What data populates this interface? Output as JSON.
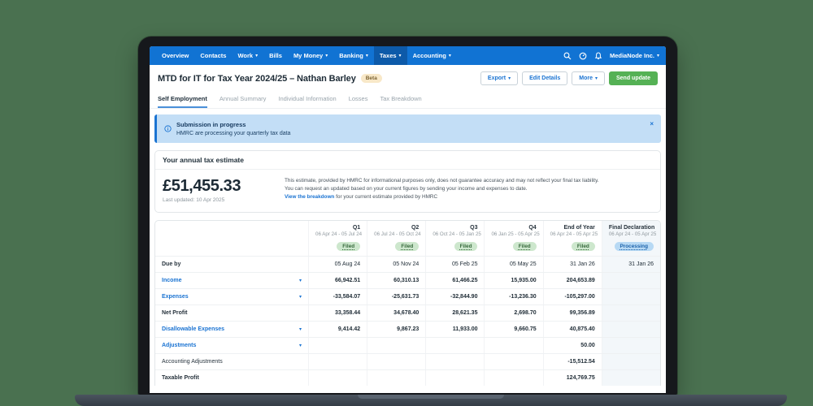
{
  "colors": {
    "background_green": "#4a7150",
    "navbar_blue": "#1173d3",
    "navbar_active_blue": "#0d5aa9",
    "link_blue": "#1a73d2",
    "banner_blue_bg": "#c3def6",
    "send_update_green": "#55b155",
    "beta_badge_bg": "#f8e8c8",
    "filed_pill_bg": "#cde7cd",
    "filed_pill_text": "#37693c",
    "processing_pill_bg": "#b7d9f4",
    "processing_pill_text": "#1f64ab"
  },
  "glyphs": {
    "caret": "▾",
    "close": "×"
  },
  "navbar": {
    "items": [
      {
        "label": "Overview"
      },
      {
        "label": "Contacts"
      },
      {
        "label": "Work",
        "dropdown": true
      },
      {
        "label": "Bills"
      },
      {
        "label": "My Money",
        "dropdown": true
      },
      {
        "label": "Banking",
        "dropdown": true
      },
      {
        "label": "Taxes",
        "dropdown": true,
        "active": true
      },
      {
        "label": "Accounting",
        "dropdown": true
      }
    ],
    "account": {
      "label": "MediaNode Inc.",
      "dropdown": true
    }
  },
  "header": {
    "title": "MTD for IT for Tax Year 2024/25 – Nathan Barley",
    "badge": "Beta",
    "buttons": [
      {
        "label": "Export",
        "dropdown": true
      },
      {
        "label": "Edit Details"
      },
      {
        "label": "More",
        "dropdown": true
      },
      {
        "label": "Send update",
        "primary": true
      }
    ]
  },
  "tabs": [
    {
      "label": "Self Employment",
      "active": true
    },
    {
      "label": "Annual Summary"
    },
    {
      "label": "Individual Information"
    },
    {
      "label": "Losses"
    },
    {
      "label": "Tax Breakdown"
    }
  ],
  "banner": {
    "title": "Submission in progress",
    "message": "HMRC are processing your quarterly tax data"
  },
  "estimate": {
    "heading": "Your annual tax estimate",
    "amount": "£51,455.33",
    "last_updated": "Last updated: 10 Apr 2025",
    "disclaimer_line1": "This estimate, provided by HMRC for informational purposes only, does not guarantee accuracy and may not reflect your final tax liability.",
    "disclaimer_line2": "You can request an updated based on your current figures by sending your income and expenses to date.",
    "breakdown_link": "View the breakdown",
    "breakdown_suffix": "for your current estimate provided by HMRC"
  },
  "table": {
    "columns": [
      {
        "label": "Q1",
        "range": "06 Apr 24 - 05 Jul 24",
        "status": "Filed"
      },
      {
        "label": "Q2",
        "range": "06 Jul 24 - 05 Oct 24",
        "status": "Filed"
      },
      {
        "label": "Q3",
        "range": "06 Oct 24 - 05 Jan 25",
        "status": "Filed"
      },
      {
        "label": "Q4",
        "range": "06 Jan 25 - 05 Apr 25",
        "status": "Filed"
      },
      {
        "label": "End of Year",
        "range": "06 Apr 24 - 05 Apr 25",
        "status": "Filed"
      },
      {
        "label": "Final Declaration",
        "range": "06 Apr 24 - 05 Apr 25",
        "status": "Processing",
        "highlight": true
      }
    ],
    "rows": [
      {
        "label": "Due by",
        "type": "strong",
        "values_bold": false,
        "values": [
          "05 Aug 24",
          "05 Nov 24",
          "05 Feb 25",
          "05 May 25",
          "31 Jan 26",
          "31 Jan 26"
        ]
      },
      {
        "label": "Income",
        "type": "link",
        "expandable": true,
        "values_bold": true,
        "values": [
          "66,942.51",
          "60,310.13",
          "61,466.25",
          "15,935.00",
          "204,653.89",
          ""
        ]
      },
      {
        "label": "Expenses",
        "type": "link",
        "expandable": true,
        "values_bold": true,
        "values": [
          "-33,584.07",
          "-25,631.73",
          "-32,844.90",
          "-13,236.30",
          "-105,297.00",
          ""
        ]
      },
      {
        "label": "Net Profit",
        "type": "strong",
        "values_bold": true,
        "values": [
          "33,358.44",
          "34,678.40",
          "28,621.35",
          "2,698.70",
          "99,356.89",
          ""
        ]
      },
      {
        "label": "Disallowable Expenses",
        "type": "link",
        "expandable": true,
        "values_bold": true,
        "values": [
          "9,414.42",
          "9,867.23",
          "11,933.00",
          "9,660.75",
          "40,875.40",
          ""
        ]
      },
      {
        "label": "Adjustments",
        "type": "link",
        "expandable": true,
        "values_bold": true,
        "values": [
          "",
          "",
          "",
          "",
          "50.00",
          ""
        ]
      },
      {
        "label": "Accounting Adjustments",
        "type": "plain",
        "values_bold": true,
        "values": [
          "",
          "",
          "",
          "",
          "-15,512.54",
          ""
        ]
      },
      {
        "label": "Taxable Profit",
        "type": "strong",
        "values_bold": true,
        "values": [
          "",
          "",
          "",
          "",
          "124,769.75",
          ""
        ]
      }
    ]
  }
}
